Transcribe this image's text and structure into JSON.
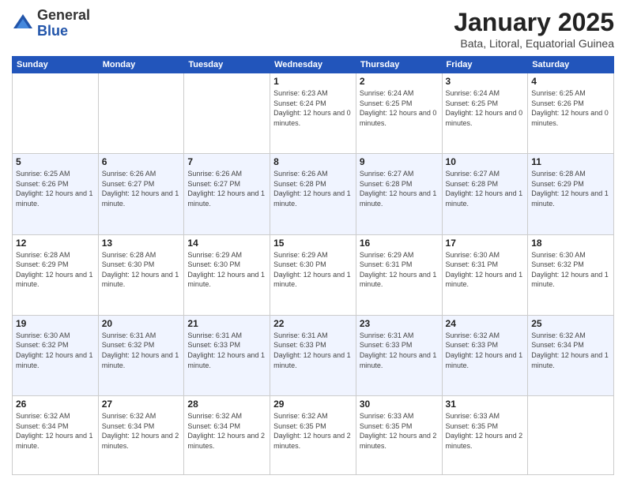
{
  "logo": {
    "general": "General",
    "blue": "Blue"
  },
  "header": {
    "month": "January 2025",
    "location": "Bata, Litoral, Equatorial Guinea"
  },
  "days_of_week": [
    "Sunday",
    "Monday",
    "Tuesday",
    "Wednesday",
    "Thursday",
    "Friday",
    "Saturday"
  ],
  "weeks": [
    [
      {
        "day": "",
        "info": ""
      },
      {
        "day": "",
        "info": ""
      },
      {
        "day": "",
        "info": ""
      },
      {
        "day": "1",
        "sunrise": "6:23 AM",
        "sunset": "6:24 PM",
        "daylight": "12 hours and 0 minutes."
      },
      {
        "day": "2",
        "sunrise": "6:24 AM",
        "sunset": "6:25 PM",
        "daylight": "12 hours and 0 minutes."
      },
      {
        "day": "3",
        "sunrise": "6:24 AM",
        "sunset": "6:25 PM",
        "daylight": "12 hours and 0 minutes."
      },
      {
        "day": "4",
        "sunrise": "6:25 AM",
        "sunset": "6:26 PM",
        "daylight": "12 hours and 0 minutes."
      }
    ],
    [
      {
        "day": "5",
        "sunrise": "6:25 AM",
        "sunset": "6:26 PM",
        "daylight": "12 hours and 1 minute."
      },
      {
        "day": "6",
        "sunrise": "6:26 AM",
        "sunset": "6:27 PM",
        "daylight": "12 hours and 1 minute."
      },
      {
        "day": "7",
        "sunrise": "6:26 AM",
        "sunset": "6:27 PM",
        "daylight": "12 hours and 1 minute."
      },
      {
        "day": "8",
        "sunrise": "6:26 AM",
        "sunset": "6:28 PM",
        "daylight": "12 hours and 1 minute."
      },
      {
        "day": "9",
        "sunrise": "6:27 AM",
        "sunset": "6:28 PM",
        "daylight": "12 hours and 1 minute."
      },
      {
        "day": "10",
        "sunrise": "6:27 AM",
        "sunset": "6:28 PM",
        "daylight": "12 hours and 1 minute."
      },
      {
        "day": "11",
        "sunrise": "6:28 AM",
        "sunset": "6:29 PM",
        "daylight": "12 hours and 1 minute."
      }
    ],
    [
      {
        "day": "12",
        "sunrise": "6:28 AM",
        "sunset": "6:29 PM",
        "daylight": "12 hours and 1 minute."
      },
      {
        "day": "13",
        "sunrise": "6:28 AM",
        "sunset": "6:30 PM",
        "daylight": "12 hours and 1 minute."
      },
      {
        "day": "14",
        "sunrise": "6:29 AM",
        "sunset": "6:30 PM",
        "daylight": "12 hours and 1 minute."
      },
      {
        "day": "15",
        "sunrise": "6:29 AM",
        "sunset": "6:30 PM",
        "daylight": "12 hours and 1 minute."
      },
      {
        "day": "16",
        "sunrise": "6:29 AM",
        "sunset": "6:31 PM",
        "daylight": "12 hours and 1 minute."
      },
      {
        "day": "17",
        "sunrise": "6:30 AM",
        "sunset": "6:31 PM",
        "daylight": "12 hours and 1 minute."
      },
      {
        "day": "18",
        "sunrise": "6:30 AM",
        "sunset": "6:32 PM",
        "daylight": "12 hours and 1 minute."
      }
    ],
    [
      {
        "day": "19",
        "sunrise": "6:30 AM",
        "sunset": "6:32 PM",
        "daylight": "12 hours and 1 minute."
      },
      {
        "day": "20",
        "sunrise": "6:31 AM",
        "sunset": "6:32 PM",
        "daylight": "12 hours and 1 minute."
      },
      {
        "day": "21",
        "sunrise": "6:31 AM",
        "sunset": "6:33 PM",
        "daylight": "12 hours and 1 minute."
      },
      {
        "day": "22",
        "sunrise": "6:31 AM",
        "sunset": "6:33 PM",
        "daylight": "12 hours and 1 minute."
      },
      {
        "day": "23",
        "sunrise": "6:31 AM",
        "sunset": "6:33 PM",
        "daylight": "12 hours and 1 minute."
      },
      {
        "day": "24",
        "sunrise": "6:32 AM",
        "sunset": "6:33 PM",
        "daylight": "12 hours and 1 minute."
      },
      {
        "day": "25",
        "sunrise": "6:32 AM",
        "sunset": "6:34 PM",
        "daylight": "12 hours and 1 minute."
      }
    ],
    [
      {
        "day": "26",
        "sunrise": "6:32 AM",
        "sunset": "6:34 PM",
        "daylight": "12 hours and 1 minute."
      },
      {
        "day": "27",
        "sunrise": "6:32 AM",
        "sunset": "6:34 PM",
        "daylight": "12 hours and 2 minutes."
      },
      {
        "day": "28",
        "sunrise": "6:32 AM",
        "sunset": "6:34 PM",
        "daylight": "12 hours and 2 minutes."
      },
      {
        "day": "29",
        "sunrise": "6:32 AM",
        "sunset": "6:35 PM",
        "daylight": "12 hours and 2 minutes."
      },
      {
        "day": "30",
        "sunrise": "6:33 AM",
        "sunset": "6:35 PM",
        "daylight": "12 hours and 2 minutes."
      },
      {
        "day": "31",
        "sunrise": "6:33 AM",
        "sunset": "6:35 PM",
        "daylight": "12 hours and 2 minutes."
      },
      {
        "day": "",
        "info": ""
      }
    ]
  ]
}
